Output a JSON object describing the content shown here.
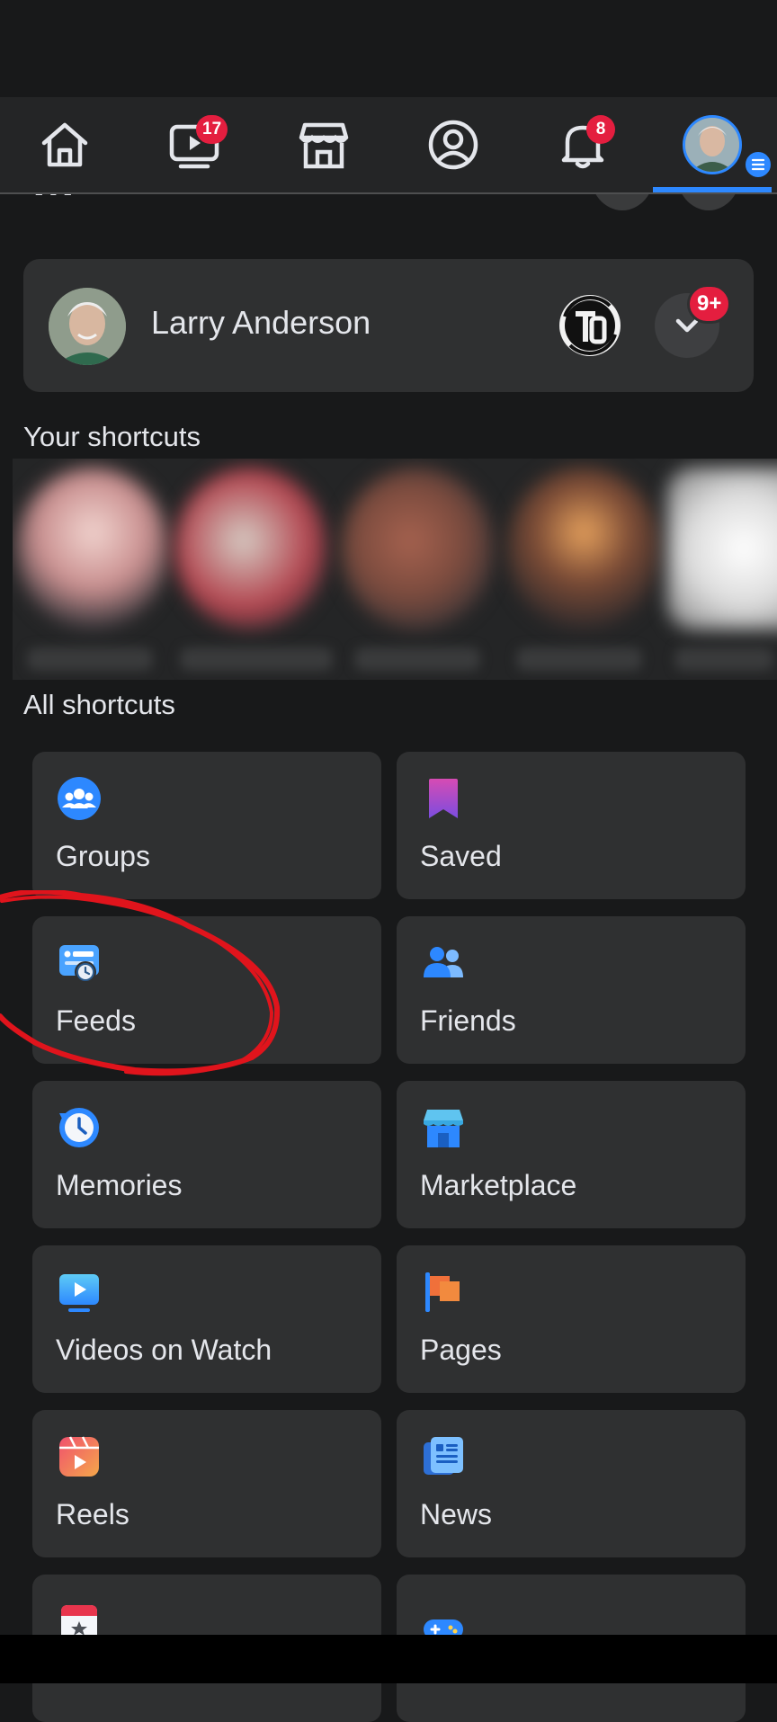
{
  "nav": {
    "video_badge": "17",
    "notifications_badge": "8"
  },
  "profile": {
    "name": "Larry Anderson",
    "more_badge": "9+"
  },
  "sections": {
    "your_shortcuts": "Your shortcuts",
    "all_shortcuts": "All shortcuts"
  },
  "tiles": [
    {
      "label": "Groups",
      "icon": "groups-icon"
    },
    {
      "label": "Saved",
      "icon": "saved-icon"
    },
    {
      "label": "Feeds",
      "icon": "feeds-icon"
    },
    {
      "label": "Friends",
      "icon": "friends-icon"
    },
    {
      "label": "Memories",
      "icon": "memories-icon"
    },
    {
      "label": "Marketplace",
      "icon": "marketplace-icon"
    },
    {
      "label": "Videos on Watch",
      "icon": "video-icon"
    },
    {
      "label": "Pages",
      "icon": "pages-icon"
    },
    {
      "label": "Reels",
      "icon": "reels-icon"
    },
    {
      "label": "News",
      "icon": "news-icon"
    }
  ],
  "colors": {
    "accent": "#2d88ff",
    "badge": "#e41e3f",
    "annotation": "#e0141c"
  }
}
